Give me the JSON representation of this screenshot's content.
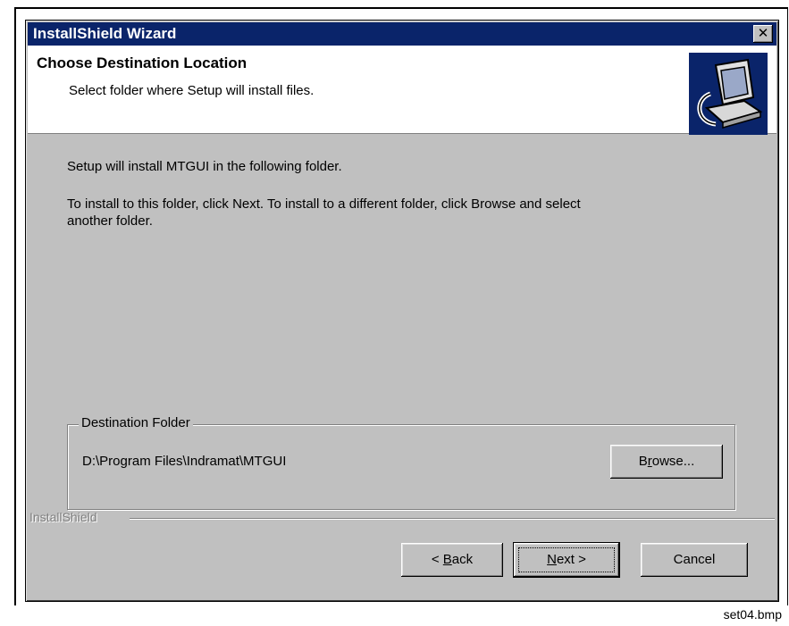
{
  "window": {
    "title": "InstallShield Wizard",
    "close_glyph": "✕"
  },
  "header": {
    "title": "Choose Destination Location",
    "subtitle": "Select folder where Setup will install files.",
    "icon": "setup-computer-icon"
  },
  "body": {
    "line1": "Setup will install MTGUI in the following folder.",
    "line2a": "To install to this folder, click Next. To install to a different folder, click Browse and select",
    "line2b": "another folder."
  },
  "destination": {
    "legend": "Destination Folder",
    "path": "D:\\Program Files\\Indramat\\MTGUI",
    "browse_pre": "B",
    "browse_ul": "r",
    "browse_post": "owse..."
  },
  "footer": {
    "brand": "InstallShield",
    "back_pre": "< ",
    "back_ul": "B",
    "back_post": "ack",
    "next_ul": "N",
    "next_post": "ext >",
    "cancel": "Cancel"
  },
  "caption": "set04.bmp"
}
